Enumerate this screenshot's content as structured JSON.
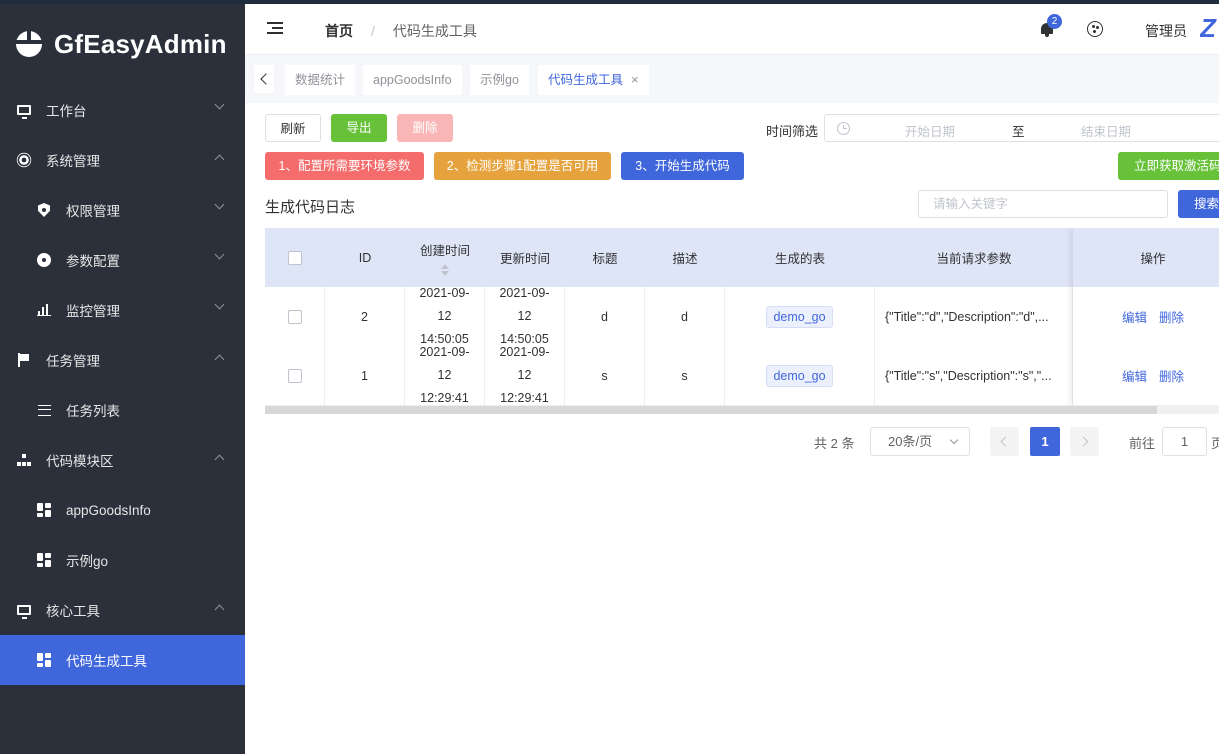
{
  "app": {
    "title": "GfEasyAdmin"
  },
  "sidebar": {
    "items": [
      {
        "label": "工作台",
        "icon": "monitor-icon",
        "expanded": false
      },
      {
        "label": "系统管理",
        "icon": "gear-icon",
        "expanded": true
      },
      {
        "label": "权限管理",
        "icon": "shield-icon",
        "expanded": false
      },
      {
        "label": "参数配置",
        "icon": "disc-icon",
        "expanded": false
      },
      {
        "label": "监控管理",
        "icon": "bar-chart-icon",
        "expanded": false
      },
      {
        "label": "任务管理",
        "icon": "flag-icon",
        "expanded": true
      },
      {
        "label": "任务列表",
        "icon": "list-icon"
      },
      {
        "label": "代码模块区",
        "icon": "sitemap-icon",
        "expanded": true
      },
      {
        "label": "appGoodsInfo",
        "icon": "grid-icon"
      },
      {
        "label": "示例go",
        "icon": "grid-icon"
      },
      {
        "label": "核心工具",
        "icon": "monitor-icon",
        "expanded": true
      },
      {
        "label": "代码生成工具",
        "icon": "grid-icon",
        "active": true
      }
    ]
  },
  "header": {
    "breadcrumb": {
      "home": "首页",
      "separator": "/",
      "current": "代码生成工具"
    },
    "notifications": "2",
    "user": "管理员",
    "avatar_text": "Z"
  },
  "tags": [
    {
      "label": "数据统计"
    },
    {
      "label": "appGoodsInfo"
    },
    {
      "label": "示例go"
    },
    {
      "label": "代码生成工具",
      "active": true,
      "close": "×"
    }
  ],
  "toolbar": {
    "refresh": "刷新",
    "export": "导出",
    "delete": "删除",
    "time_filter": "时间筛选",
    "start_placeholder": "开始日期",
    "range_sep": "至",
    "end_placeholder": "结束日期",
    "step1": "1、配置所需要环境参数",
    "step2": "2、检测步骤1配置是否可用",
    "step3": "3、开始生成代码",
    "activate": "立即获取激活码"
  },
  "section": {
    "title": "生成代码日志",
    "search_placeholder": "请输入关键字",
    "search_btn": "搜索"
  },
  "table": {
    "columns": [
      "ID",
      "创建时间",
      "更新时间",
      "标题",
      "描述",
      "生成的表",
      "当前请求参数",
      "操作"
    ],
    "rows": [
      {
        "id": "2",
        "created": "2021-09-12 14:50:05",
        "updated": "2021-09-12 14:50:05",
        "title": "d",
        "desc": "d",
        "table": "demo_go",
        "params": "{\"Title\":\"d\",\"Description\":\"d\",...",
        "edit": "编辑",
        "delete": "删除"
      },
      {
        "id": "1",
        "created": "2021-09-12 12:29:41",
        "updated": "2021-09-12 12:29:41",
        "title": "s",
        "desc": "s",
        "table": "demo_go",
        "params": "{\"Title\":\"s\",\"Description\":\"s\",\"...",
        "edit": "编辑",
        "delete": "删除"
      }
    ]
  },
  "pagination": {
    "total": "共 2 条",
    "page_size": "20条/页",
    "current": "1",
    "goto_label": "前往",
    "goto_value": "1",
    "goto_suffix": "页"
  },
  "colors": {
    "accent": "#4066dc",
    "sidebar_bg": "#2b303b",
    "success": "#67c23a",
    "danger": "#f56c6c",
    "warning": "#e6a23c"
  }
}
